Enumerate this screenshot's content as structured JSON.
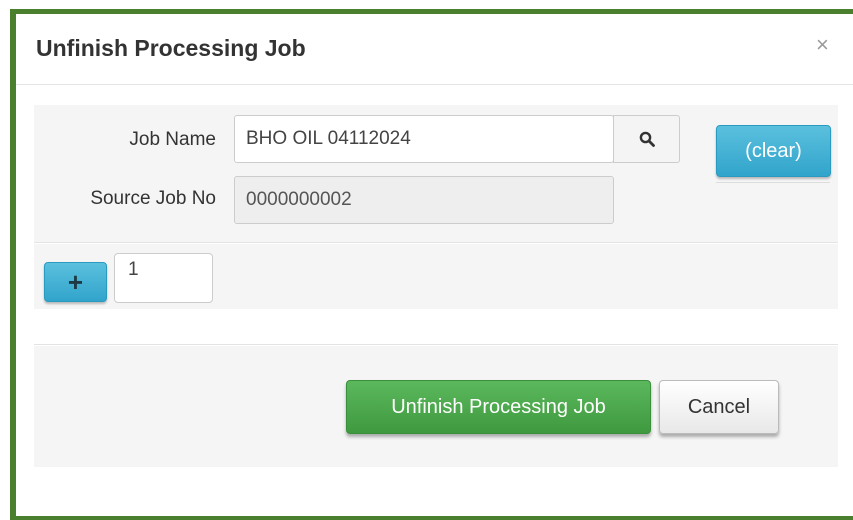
{
  "dialog": {
    "title": "Unfinish Processing Job",
    "close_glyph": "×"
  },
  "form": {
    "job_name_label": "Job Name",
    "job_name_value": "BHO OIL 04112024",
    "source_job_no_label": "Source Job No",
    "source_job_no_value": "0000000002",
    "clear_label": "(clear)",
    "add_glyph": "+",
    "count_value": "1"
  },
  "footer": {
    "submit_label": "Unfinish Processing Job",
    "cancel_label": "Cancel"
  },
  "icons": {
    "search": "search-icon",
    "close": "close-icon",
    "plus": "plus-icon"
  },
  "colors": {
    "frame": "#4a7f2e",
    "info": "#31a4cb",
    "success": "#45a845"
  }
}
